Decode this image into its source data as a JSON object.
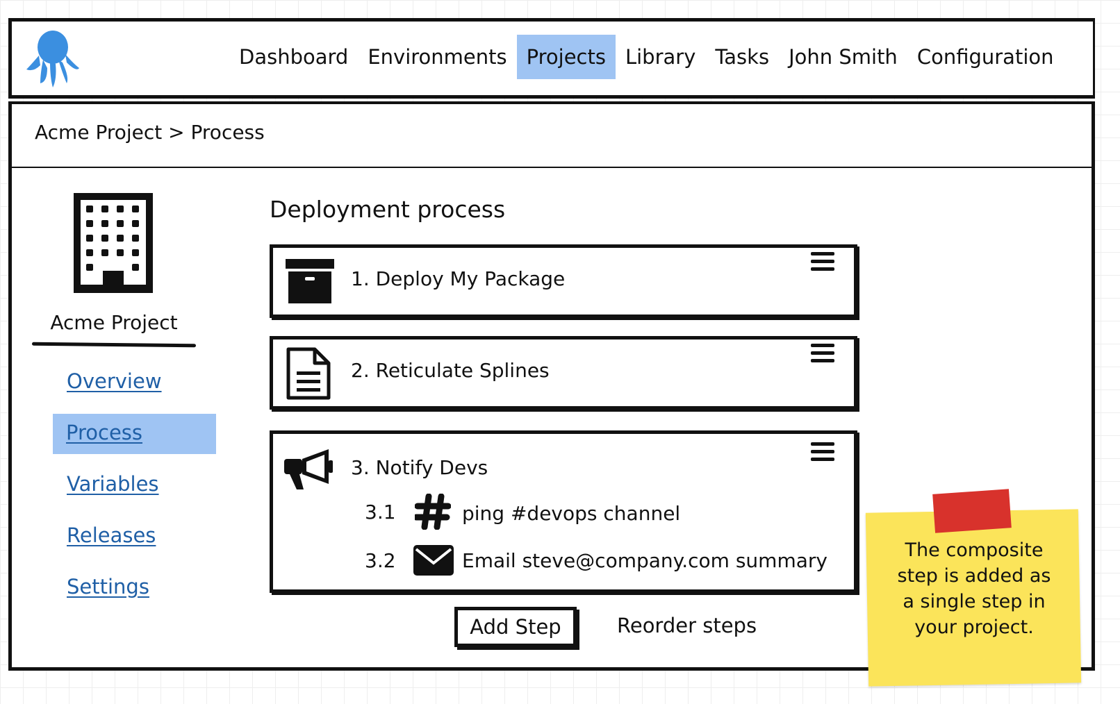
{
  "nav": {
    "items": [
      {
        "label": "Dashboard"
      },
      {
        "label": "Environments"
      },
      {
        "label": "Projects"
      },
      {
        "label": "Library"
      },
      {
        "label": "Tasks"
      },
      {
        "label": "John Smith"
      },
      {
        "label": "Configuration"
      }
    ],
    "active": "Projects"
  },
  "breadcrumb": "Acme Project > Process",
  "project": {
    "name": "Acme Project",
    "links": [
      "Overview",
      "Process",
      "Variables",
      "Releases",
      "Settings"
    ],
    "active_link": "Process"
  },
  "main": {
    "heading": "Deployment process",
    "steps": [
      {
        "title": "1. Deploy My Package",
        "icon": "archive-box-icon"
      },
      {
        "title": "2. Reticulate Splines",
        "icon": "document-icon"
      },
      {
        "title": "3. Notify Devs",
        "icon": "megaphone-icon",
        "children": [
          {
            "num": "3.1",
            "icon": "hashtag-icon",
            "text": "ping #devops channel"
          },
          {
            "num": "3.2",
            "icon": "envelope-icon",
            "text": "Email steve@company.com summary"
          }
        ]
      }
    ],
    "add_step_label": "Add Step",
    "reorder_label": "Reorder steps"
  },
  "note": {
    "lines": [
      "The composite",
      "step is added as",
      "a single step in",
      "your project."
    ]
  },
  "colors": {
    "active_highlight": "#9fc4f3",
    "link": "#1f5fa6",
    "note": "#fbe45a",
    "tape": "#d8322c"
  }
}
